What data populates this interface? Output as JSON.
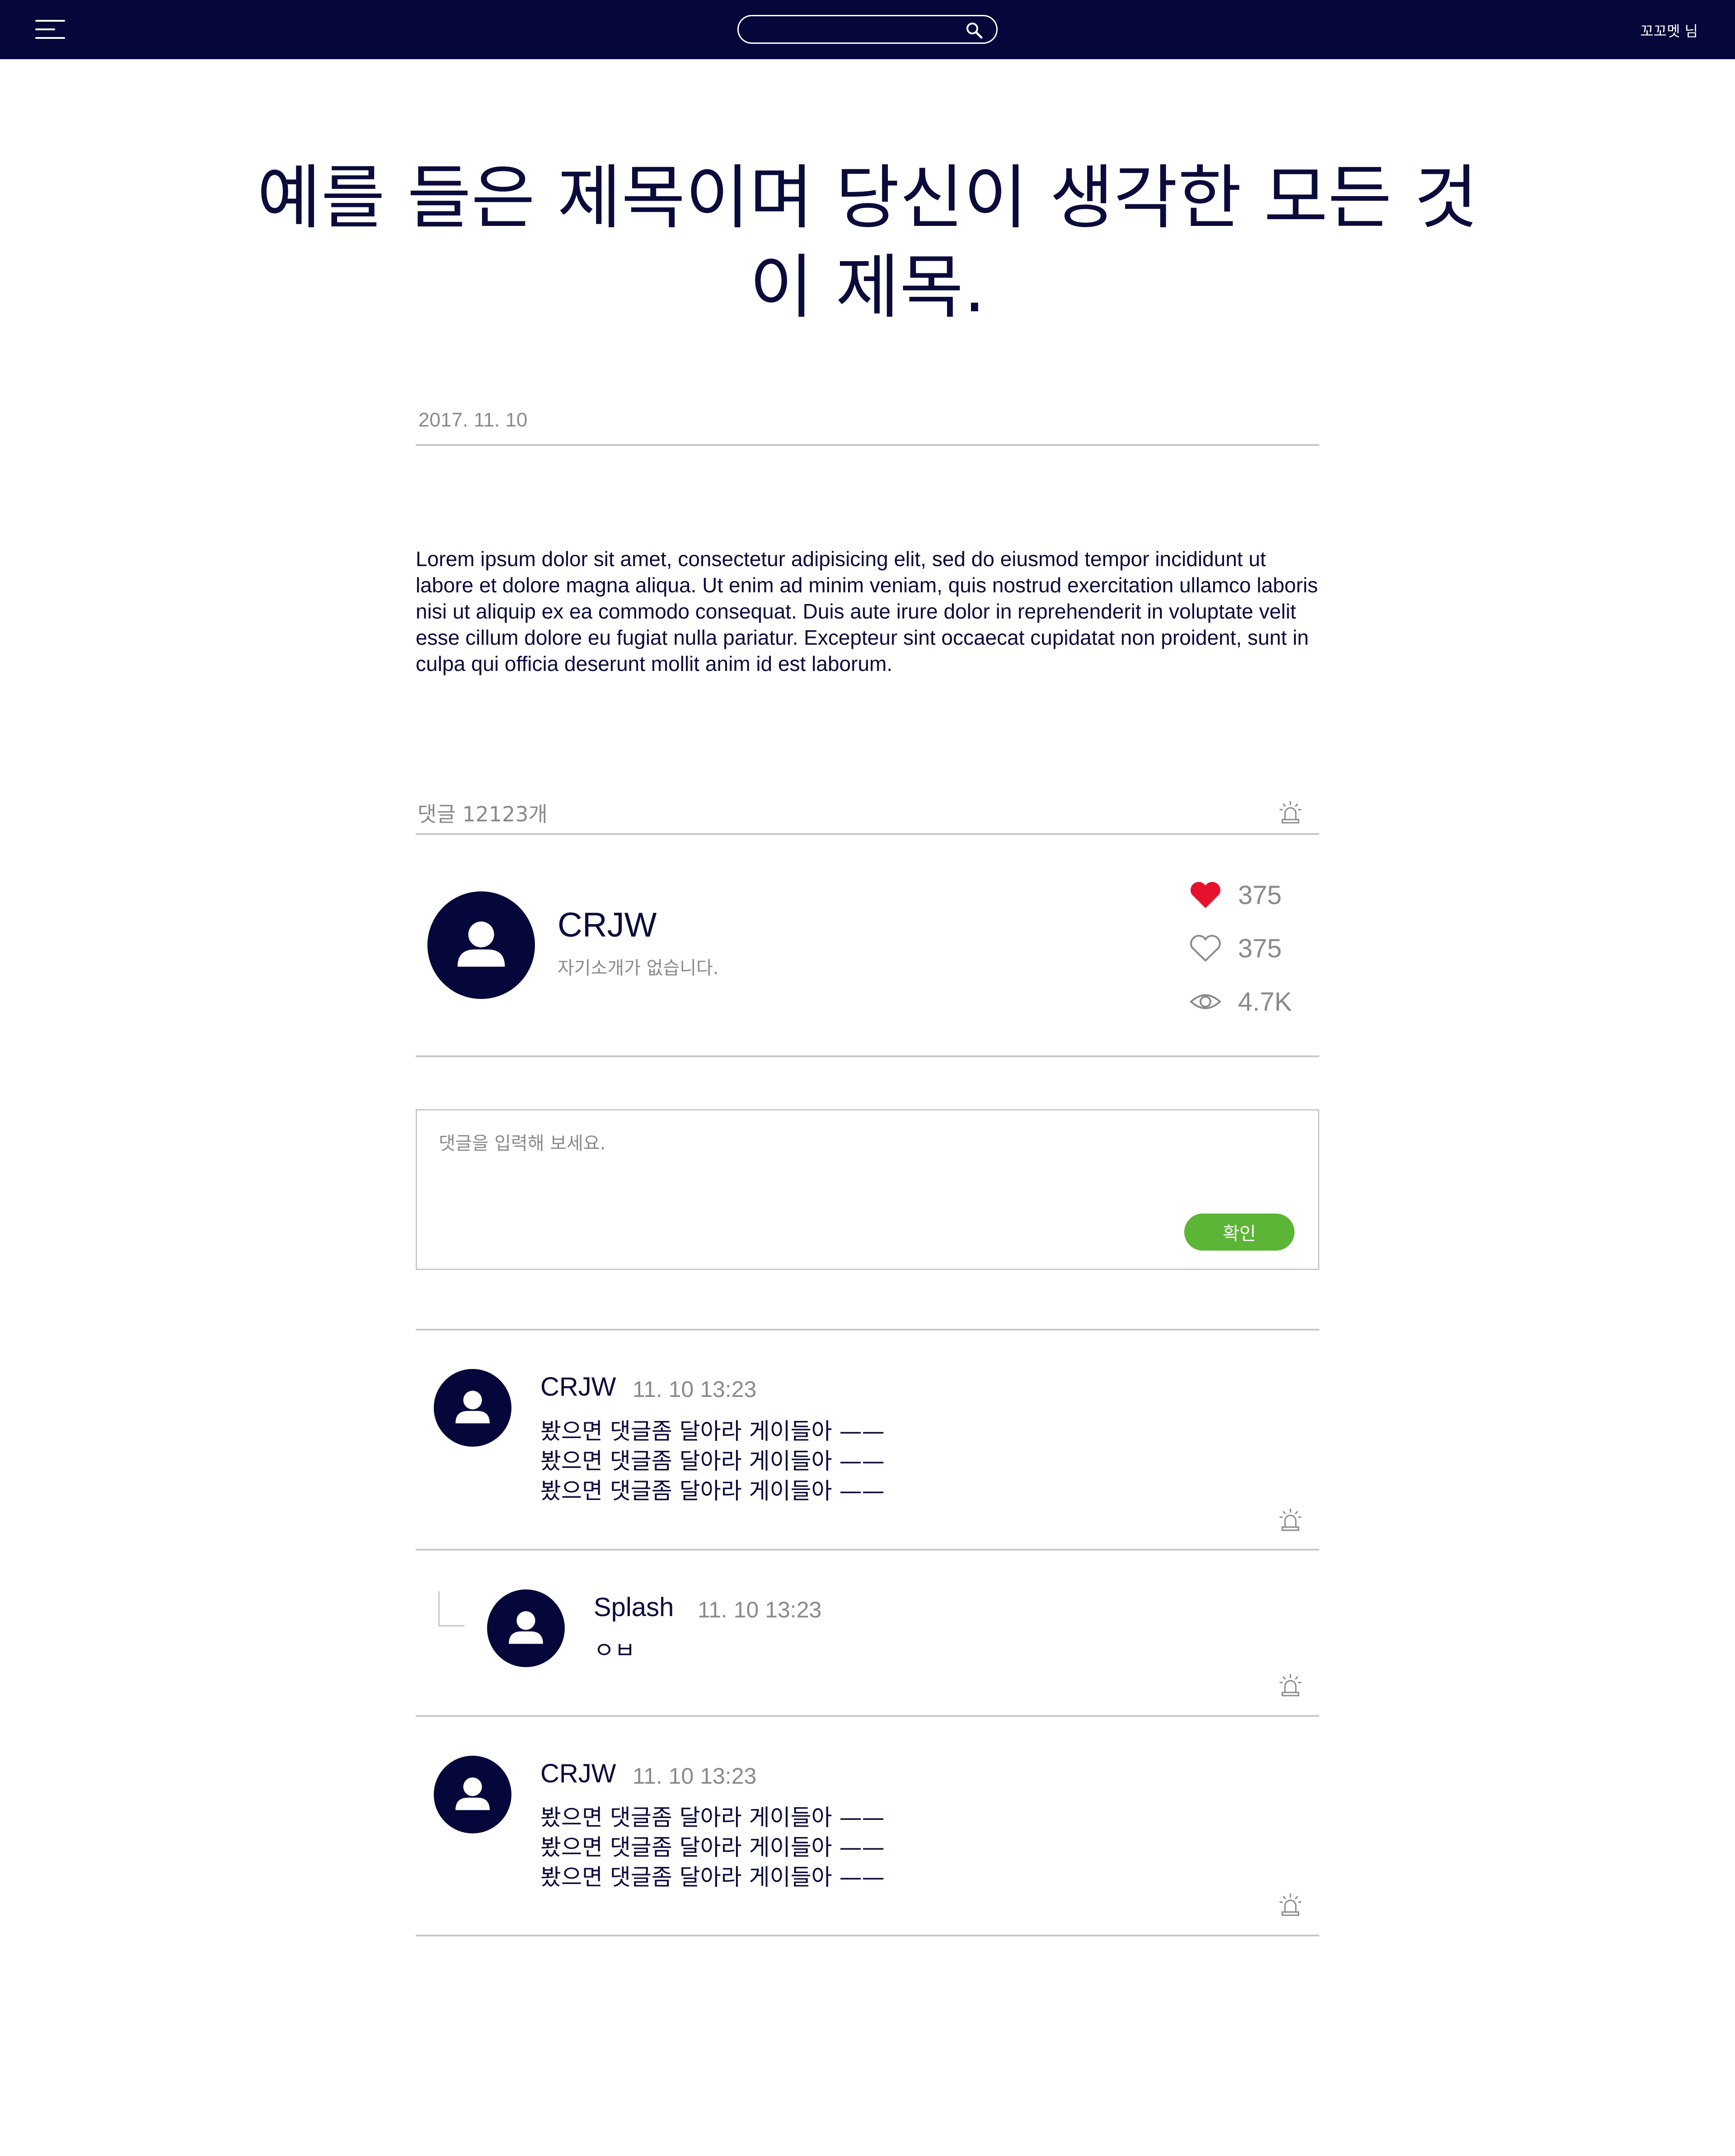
{
  "header": {
    "search_placeholder": "",
    "user_label": "꼬꼬멧 님"
  },
  "article": {
    "title": "예를 들은 제목이며 당신이 생각한 모든 것이 제목.",
    "date": "2017. 11. 10",
    "body": "Lorem ipsum dolor sit amet, consectetur adipisicing elit, sed do eiusmod tempor incididunt ut labore et dolore magna aliqua. Ut enim ad minim veniam, quis nostrud exercitation ullamco laboris nisi ut aliquip ex ea commodo consequat. Duis aute irure dolor in reprehenderit in voluptate velit esse cillum dolore eu fugiat nulla pariatur. Excepteur sint occaecat cupidatat non proident, sunt in culpa qui officia deserunt mollit anim id est laborum."
  },
  "comments_section": {
    "count_label": "댓글 12123개"
  },
  "author": {
    "name": "CRJW",
    "bio": "자기소개가 없습니다.",
    "likes": "375",
    "favorites": "375",
    "views": "4.7K"
  },
  "comment_form": {
    "placeholder": "댓글을 입력해 보세요.",
    "submit_label": "확인"
  },
  "colors": {
    "navy": "#05073a",
    "accent_green": "#5cb536",
    "heart_red": "#e8112d",
    "muted_gray": "#8a8a8a"
  },
  "comments": [
    {
      "author": "CRJW",
      "time": "11. 10 13:23",
      "text": "봤으면 댓글좀 달아라 게이들아 ——\n봤으면 댓글좀 달아라 게이들아 ——\n봤으면 댓글좀 달아라 게이들아 ——"
    },
    {
      "author": "Splash",
      "time": "11. 10 13:23",
      "text": "ㅇㅂ",
      "is_reply": true
    },
    {
      "author": "CRJW",
      "time": "11. 10 13:23",
      "text": "봤으면 댓글좀 달아라 게이들아 ——\n봤으면 댓글좀 달아라 게이들아 ——\n봤으면 댓글좀 달아라 게이들아 ——"
    }
  ]
}
